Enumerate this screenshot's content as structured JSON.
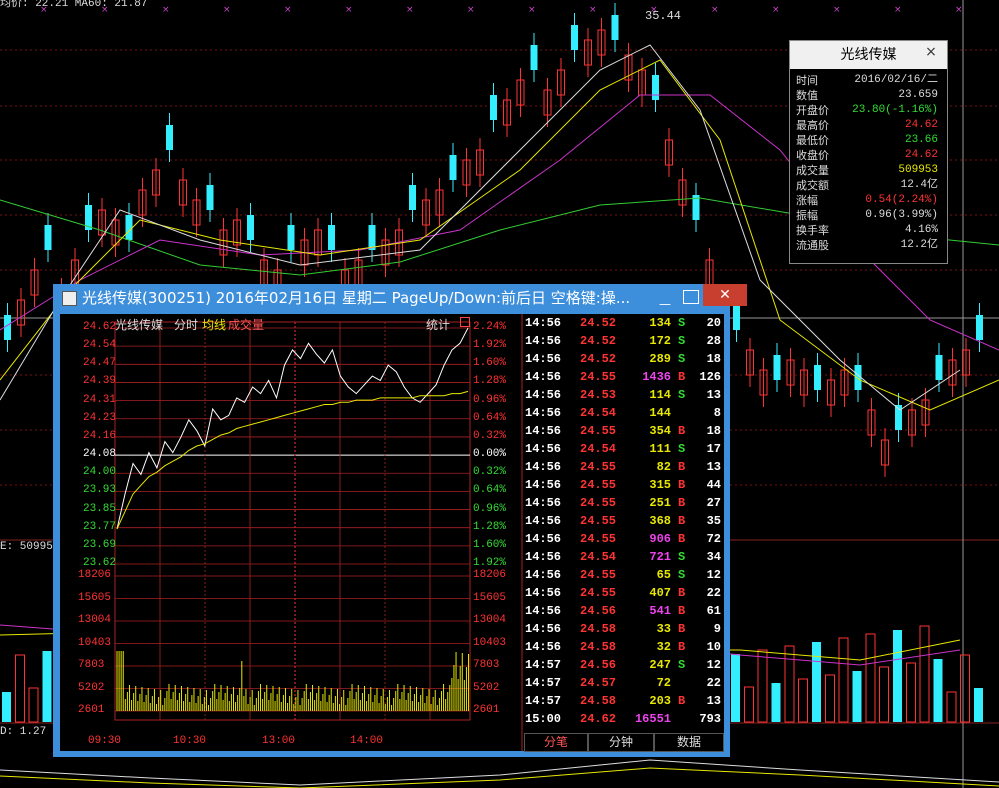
{
  "background": {
    "top_left_label": "均价: 22.21   MA60: 21.87",
    "top_price_label": "35.44",
    "vol_label": "E: 50995",
    "macd_label": "D: 1.27"
  },
  "info_panel": {
    "title": "光线传媒",
    "close_symbol": "×",
    "rows": [
      {
        "label": "时间",
        "value": "2016/02/16/二",
        "color": "#dddddd"
      },
      {
        "label": "数值",
        "value": "23.659",
        "color": "#dddddd"
      },
      {
        "label": "开盘价",
        "value": "23.80(-1.16%)",
        "color": "#33dd33"
      },
      {
        "label": "最高价",
        "value": "24.62",
        "color": "#ff3333"
      },
      {
        "label": "最低价",
        "value": "23.66",
        "color": "#33dd33"
      },
      {
        "label": "收盘价",
        "value": "24.62",
        "color": "#ff3333"
      },
      {
        "label": "成交量",
        "value": "509953",
        "color": "#e8e800"
      },
      {
        "label": "成交额",
        "value": "12.4亿",
        "color": "#dddddd"
      },
      {
        "label": "涨幅",
        "value": "0.54(2.24%)",
        "color": "#ff3333"
      },
      {
        "label": "振幅",
        "value": "0.96(3.99%)",
        "color": "#dddddd"
      },
      {
        "label": "换手率",
        "value": "4.16%",
        "color": "#dddddd"
      },
      {
        "label": "流通股",
        "value": "12.2亿",
        "color": "#dddddd"
      }
    ]
  },
  "window": {
    "title": "光线传媒(300251) 2016年02月16日 星期二 PageUp/Down:前后日 空格键:操...",
    "close_symbol": "✕",
    "min_symbol": "—"
  },
  "chart_header": {
    "name": "光线传媒",
    "tab_fenshi": "分时",
    "tab_junxian": "均线",
    "tab_chengjiaoliang": "成交量",
    "tongji": "统计"
  },
  "chart_data": {
    "type": "line",
    "title": "光线传媒",
    "x_ticks": [
      "09:30",
      "10:30",
      "13:00",
      "14:00"
    ],
    "price_ticks": [
      "24.62",
      "24.54",
      "24.47",
      "24.39",
      "24.31",
      "24.23",
      "24.16",
      "24.08",
      "24.00",
      "23.93",
      "23.85",
      "23.77",
      "23.69",
      "23.62"
    ],
    "pct_ticks": [
      "2.24%",
      "1.92%",
      "1.60%",
      "1.28%",
      "0.96%",
      "0.64%",
      "0.32%",
      "0.00%",
      "0.32%",
      "0.64%",
      "0.96%",
      "1.28%",
      "1.60%",
      "1.92%"
    ],
    "volume_ticks": [
      "18206",
      "15605",
      "13004",
      "10403",
      "7803",
      "5202",
      "2601"
    ],
    "prev_close": 24.08,
    "ylim": [
      23.54,
      24.62
    ],
    "series": [
      {
        "name": "分时",
        "values": [
          23.7,
          23.86,
          24.0,
          23.95,
          24.05,
          23.98,
          24.1,
          24.05,
          24.12,
          24.2,
          24.15,
          24.08,
          24.25,
          24.2,
          24.22,
          24.3,
          24.28,
          24.35,
          24.32,
          24.38,
          24.3,
          24.45,
          24.52,
          24.48,
          24.55,
          24.5,
          24.46,
          24.52,
          24.4,
          24.35,
          24.32,
          24.36,
          24.4,
          24.38,
          24.45,
          24.42,
          24.35,
          24.3,
          24.28,
          24.32,
          24.36,
          24.45,
          24.52,
          24.55,
          24.62
        ]
      },
      {
        "name": "均线",
        "values": [
          23.7,
          23.78,
          23.86,
          23.9,
          23.94,
          23.96,
          23.99,
          24.01,
          24.03,
          24.06,
          24.08,
          24.09,
          24.11,
          24.13,
          24.14,
          24.16,
          24.17,
          24.18,
          24.19,
          24.2,
          24.21,
          24.22,
          24.23,
          24.24,
          24.25,
          24.26,
          24.27,
          24.27,
          24.28,
          24.28,
          24.29,
          24.29,
          24.29,
          24.3,
          24.3,
          24.3,
          24.3,
          24.3,
          24.31,
          24.31,
          24.31,
          24.31,
          24.32,
          24.32,
          24.33
        ]
      }
    ]
  },
  "trades": [
    {
      "time": "14:56",
      "price": "24.52",
      "vol": "134",
      "side": "S",
      "n": "20",
      "pc": "#ff3333",
      "vc": "#e8e800",
      "sc": "#33dd33"
    },
    {
      "time": "14:56",
      "price": "24.52",
      "vol": "172",
      "side": "S",
      "n": "28",
      "pc": "#ff3333",
      "vc": "#e8e800",
      "sc": "#33dd33"
    },
    {
      "time": "14:56",
      "price": "24.52",
      "vol": "289",
      "side": "S",
      "n": "18",
      "pc": "#ff3333",
      "vc": "#e8e800",
      "sc": "#33dd33"
    },
    {
      "time": "14:56",
      "price": "24.55",
      "vol": "1436",
      "side": "B",
      "n": "126",
      "pc": "#ff3333",
      "vc": "#ee44ee",
      "sc": "#ff3333"
    },
    {
      "time": "14:56",
      "price": "24.53",
      "vol": "114",
      "side": "S",
      "n": "13",
      "pc": "#ff3333",
      "vc": "#e8e800",
      "sc": "#33dd33"
    },
    {
      "time": "14:56",
      "price": "24.54",
      "vol": "144",
      "side": "",
      "n": "8",
      "pc": "#ff3333",
      "vc": "#e8e800",
      "sc": "#ffffff"
    },
    {
      "time": "14:56",
      "price": "24.55",
      "vol": "354",
      "side": "B",
      "n": "18",
      "pc": "#ff3333",
      "vc": "#e8e800",
      "sc": "#ff3333"
    },
    {
      "time": "14:56",
      "price": "24.54",
      "vol": "111",
      "side": "S",
      "n": "17",
      "pc": "#ff3333",
      "vc": "#e8e800",
      "sc": "#33dd33"
    },
    {
      "time": "14:56",
      "price": "24.55",
      "vol": "82",
      "side": "B",
      "n": "13",
      "pc": "#ff3333",
      "vc": "#e8e800",
      "sc": "#ff3333"
    },
    {
      "time": "14:56",
      "price": "24.55",
      "vol": "315",
      "side": "B",
      "n": "44",
      "pc": "#ff3333",
      "vc": "#e8e800",
      "sc": "#ff3333"
    },
    {
      "time": "14:56",
      "price": "24.55",
      "vol": "251",
      "side": "B",
      "n": "27",
      "pc": "#ff3333",
      "vc": "#e8e800",
      "sc": "#ff3333"
    },
    {
      "time": "14:56",
      "price": "24.55",
      "vol": "368",
      "side": "B",
      "n": "35",
      "pc": "#ff3333",
      "vc": "#e8e800",
      "sc": "#ff3333"
    },
    {
      "time": "14:56",
      "price": "24.55",
      "vol": "906",
      "side": "B",
      "n": "72",
      "pc": "#ff3333",
      "vc": "#ee44ee",
      "sc": "#ff3333"
    },
    {
      "time": "14:56",
      "price": "24.54",
      "vol": "721",
      "side": "S",
      "n": "34",
      "pc": "#ff3333",
      "vc": "#ee44ee",
      "sc": "#33dd33"
    },
    {
      "time": "14:56",
      "price": "24.55",
      "vol": "65",
      "side": "S",
      "n": "12",
      "pc": "#ff3333",
      "vc": "#e8e800",
      "sc": "#33dd33"
    },
    {
      "time": "14:56",
      "price": "24.55",
      "vol": "407",
      "side": "B",
      "n": "22",
      "pc": "#ff3333",
      "vc": "#e8e800",
      "sc": "#ff3333"
    },
    {
      "time": "14:56",
      "price": "24.56",
      "vol": "541",
      "side": "B",
      "n": "61",
      "pc": "#ff3333",
      "vc": "#ee44ee",
      "sc": "#ff3333"
    },
    {
      "time": "14:56",
      "price": "24.58",
      "vol": "33",
      "side": "B",
      "n": "9",
      "pc": "#ff3333",
      "vc": "#e8e800",
      "sc": "#ff3333"
    },
    {
      "time": "14:56",
      "price": "24.58",
      "vol": "32",
      "side": "B",
      "n": "10",
      "pc": "#ff3333",
      "vc": "#e8e800",
      "sc": "#ff3333"
    },
    {
      "time": "14:57",
      "price": "24.56",
      "vol": "247",
      "side": "S",
      "n": "12",
      "pc": "#ff3333",
      "vc": "#e8e800",
      "sc": "#33dd33"
    },
    {
      "time": "14:57",
      "price": "24.57",
      "vol": "72",
      "side": "",
      "n": "22",
      "pc": "#ff3333",
      "vc": "#e8e800",
      "sc": "#ffffff"
    },
    {
      "time": "14:57",
      "price": "24.58",
      "vol": "203",
      "side": "B",
      "n": "13",
      "pc": "#ff3333",
      "vc": "#e8e800",
      "sc": "#ff3333"
    },
    {
      "time": "15:00",
      "price": "24.62",
      "vol": "16551",
      "side": "",
      "n": "793",
      "pc": "#ff3333",
      "vc": "#ee44ee",
      "sc": "#ffffff"
    }
  ],
  "tabs": {
    "fenbi": "分笔",
    "fenzhong": "分钟",
    "shuju": "数据"
  }
}
